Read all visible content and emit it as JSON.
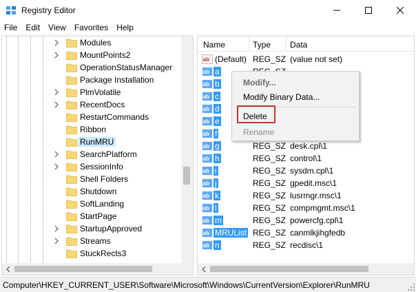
{
  "window": {
    "title": "Registry Editor"
  },
  "menu": [
    "File",
    "Edit",
    "View",
    "Favorites",
    "Help"
  ],
  "tree": {
    "items": [
      {
        "label": "Modules",
        "expandable": true
      },
      {
        "label": "MountPoints2",
        "expandable": true
      },
      {
        "label": "OperationStatusManager",
        "expandable": false
      },
      {
        "label": "Package Installation",
        "expandable": false
      },
      {
        "label": "PlmVolatile",
        "expandable": true
      },
      {
        "label": "RecentDocs",
        "expandable": true
      },
      {
        "label": "RestartCommands",
        "expandable": false
      },
      {
        "label": "Ribbon",
        "expandable": false
      },
      {
        "label": "RunMRU",
        "expandable": false,
        "selected": true
      },
      {
        "label": "SearchPlatform",
        "expandable": true
      },
      {
        "label": "SessionInfo",
        "expandable": true
      },
      {
        "label": "Shell Folders",
        "expandable": false
      },
      {
        "label": "Shutdown",
        "expandable": false
      },
      {
        "label": "SoftLanding",
        "expandable": false
      },
      {
        "label": "StartPage",
        "expandable": false
      },
      {
        "label": "StartupApproved",
        "expandable": true
      },
      {
        "label": "Streams",
        "expandable": true
      },
      {
        "label": "StuckRects3",
        "expandable": false
      }
    ]
  },
  "list": {
    "columns": [
      "Name",
      "Type",
      "Data"
    ],
    "rows": [
      {
        "name": "(Default)",
        "type": "REG_SZ",
        "data": "(value not set)",
        "selected": false
      },
      {
        "name": "a",
        "type": "REG_SZ",
        "data": "",
        "selected": true
      },
      {
        "name": "b",
        "type": "",
        "data": "",
        "selected": true
      },
      {
        "name": "c",
        "type": "",
        "data": "",
        "selected": true
      },
      {
        "name": "d",
        "type": "",
        "data": "",
        "selected": true
      },
      {
        "name": "e",
        "type": "",
        "data": "",
        "selected": true
      },
      {
        "name": "f",
        "type": "",
        "data": "",
        "selected": true
      },
      {
        "name": "g",
        "type": "REG_SZ",
        "data": "desk.cpl\\1",
        "selected": true
      },
      {
        "name": "h",
        "type": "REG_SZ",
        "data": "control\\1",
        "selected": true
      },
      {
        "name": "i",
        "type": "REG_SZ",
        "data": "sysdm.cpl\\1",
        "selected": true
      },
      {
        "name": "j",
        "type": "REG_SZ",
        "data": "gpedit.msc\\1",
        "selected": true
      },
      {
        "name": "k",
        "type": "REG_SZ",
        "data": "lusrmgr.msc\\1",
        "selected": true
      },
      {
        "name": "l",
        "type": "REG_SZ",
        "data": "compmgmt.msc\\1",
        "selected": true
      },
      {
        "name": "m",
        "type": "REG_SZ",
        "data": "powercfg.cpl\\1",
        "selected": true
      },
      {
        "name": "MRUList",
        "type": "REG_SZ",
        "data": "canmlkjihgfedb",
        "selected": true
      },
      {
        "name": "n",
        "type": "REG_SZ",
        "data": "recdisc\\1",
        "selected": true
      }
    ]
  },
  "context_menu": {
    "modify": "Modify...",
    "modify_binary": "Modify Binary Data...",
    "delete": "Delete",
    "rename": "Rename"
  },
  "status": {
    "path": "Computer\\HKEY_CURRENT_USER\\Software\\Microsoft\\Windows\\CurrentVersion\\Explorer\\RunMRU"
  },
  "colors": {
    "selection": "#3399ff",
    "tree_selection": "#cce8ff",
    "folder": "#f8d775",
    "highlight_box": "#c0392b",
    "value_icon": "#2f6fd1"
  }
}
